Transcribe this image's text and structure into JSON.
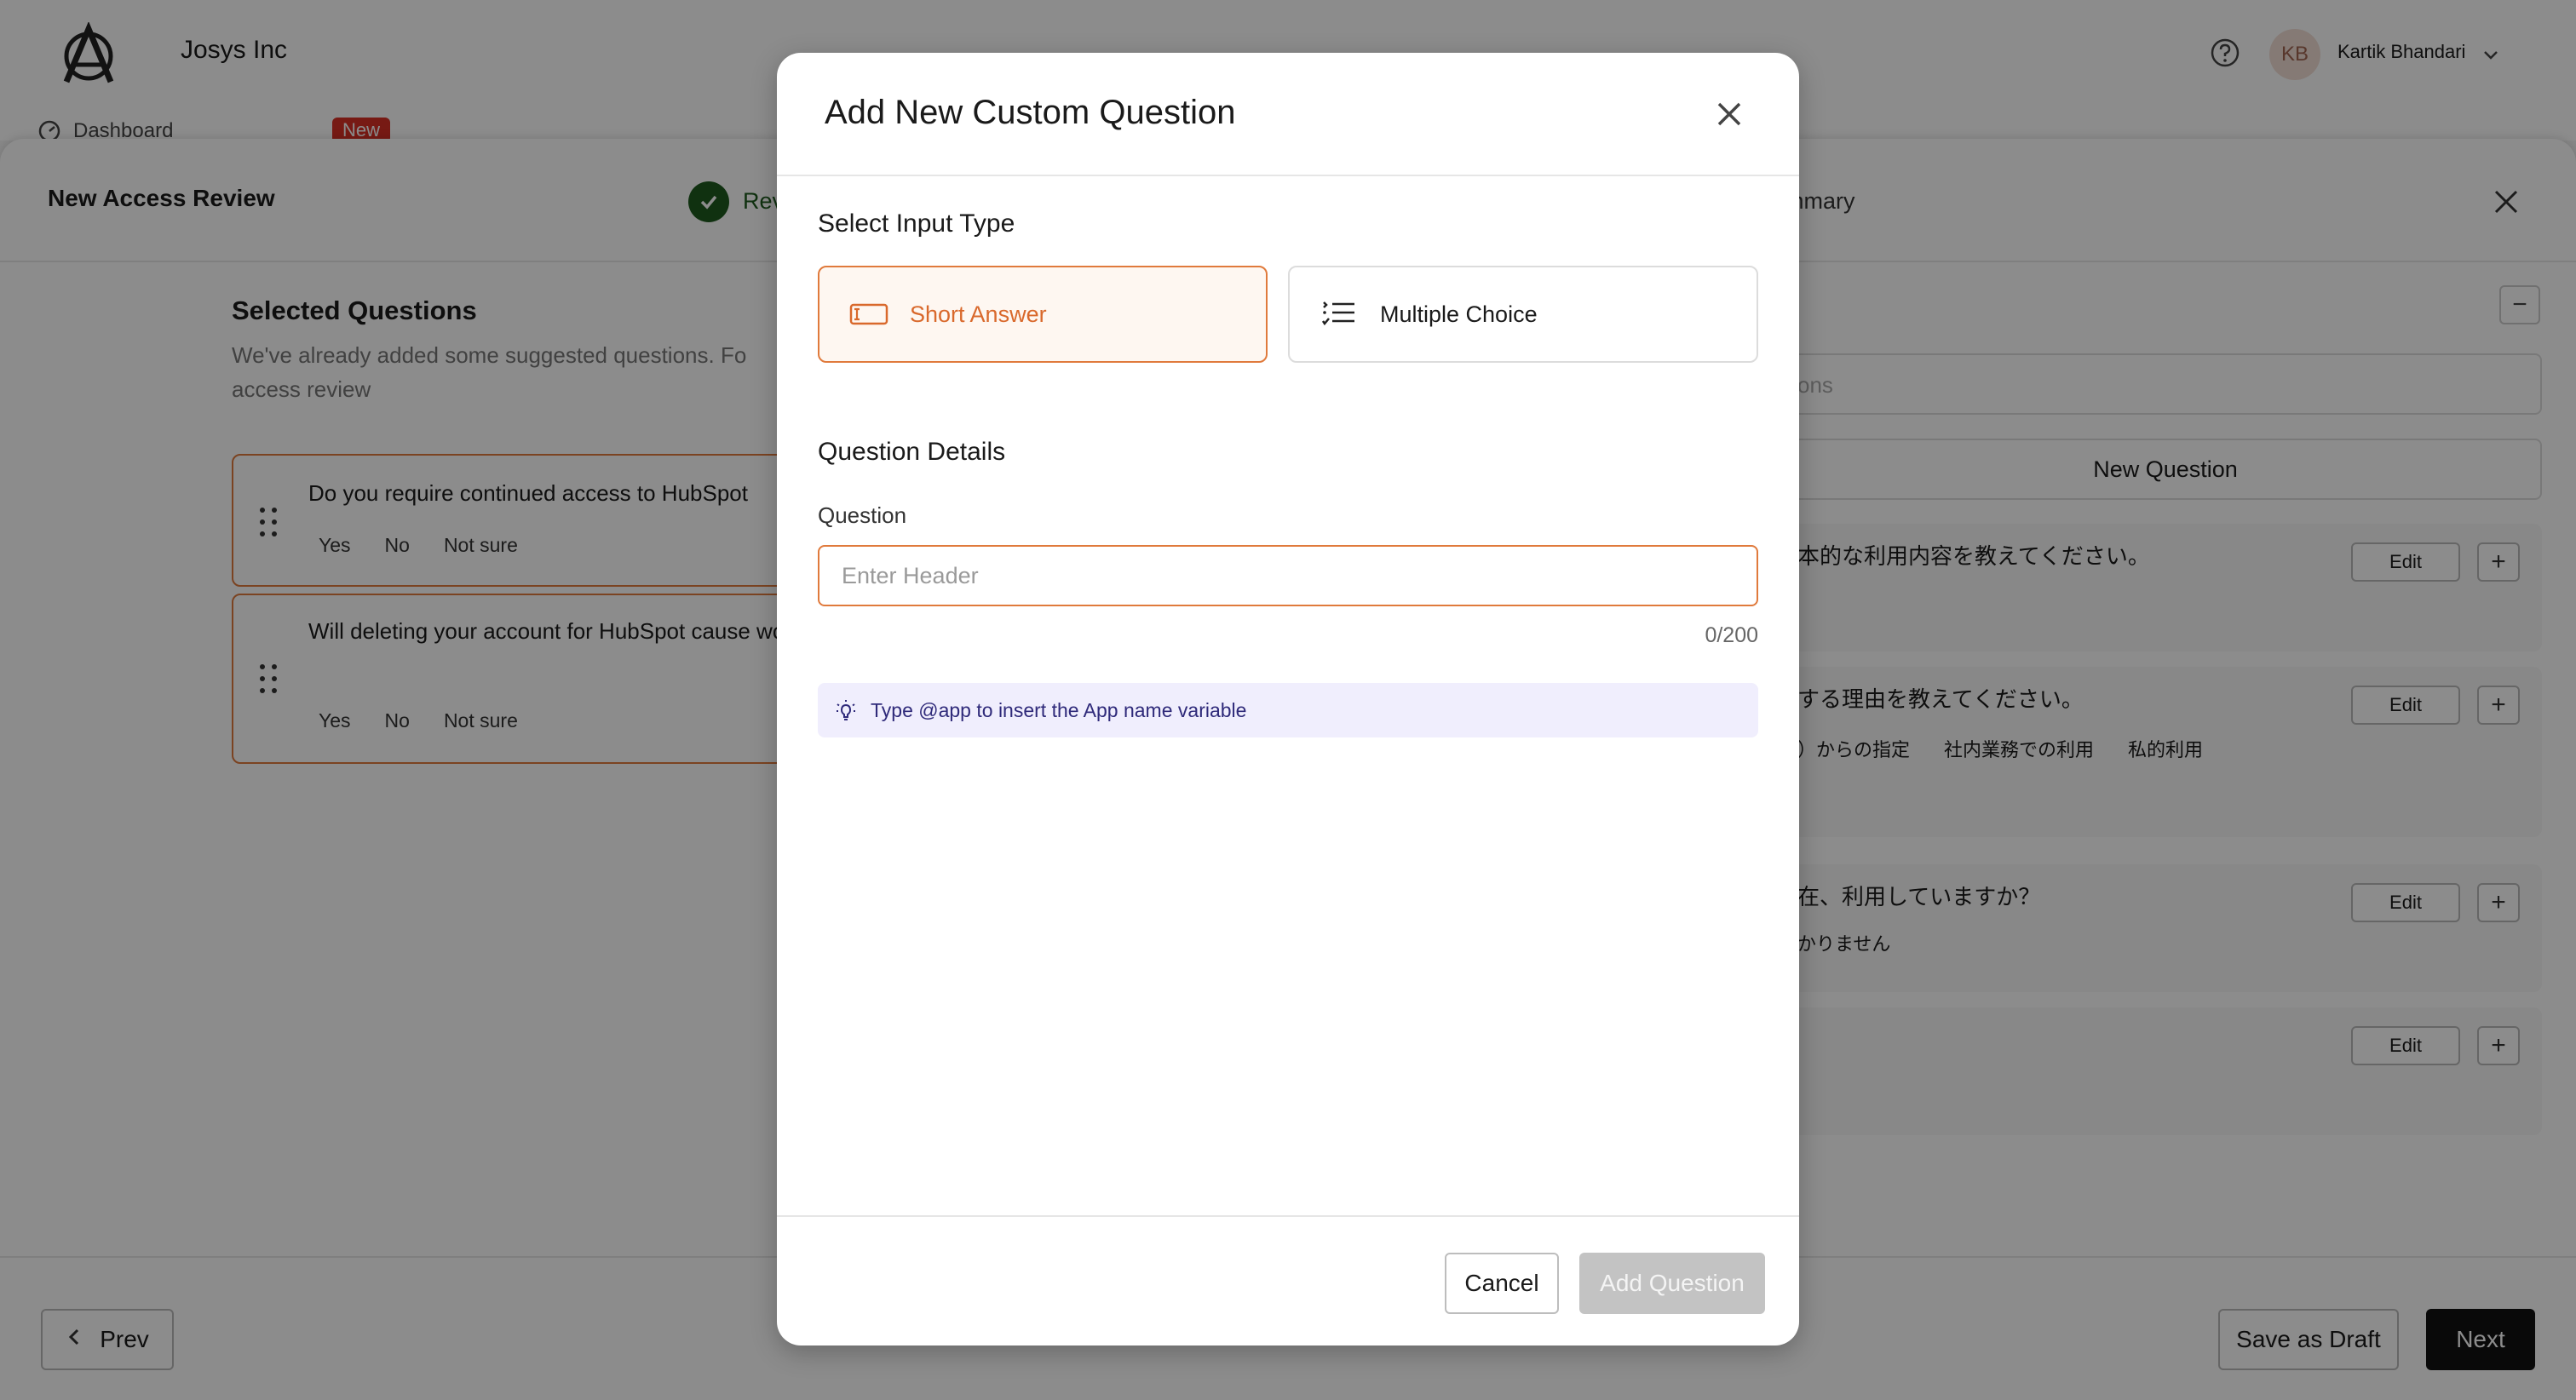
{
  "app": {
    "org_name": "Josys Inc",
    "nav_dashboard": "Dashboard",
    "nav_badge": "New"
  },
  "user": {
    "initials": "KB",
    "name": "Kartik Bhandari"
  },
  "wizard": {
    "title": "New Access Review",
    "step_review_label": "Rev",
    "step_summary_label": "ummary",
    "selected_title": "Selected Questions",
    "selected_desc": "We've already added some suggested questions. Fo access review",
    "questions": [
      {
        "text": "Do you require continued access to HubSpot",
        "options": [
          "Yes",
          "No",
          "Not sure"
        ]
      },
      {
        "text": "Will deleting your account for HubSpot cause work?",
        "options": [
          "Yes",
          "No",
          "Not sure"
        ]
      }
    ],
    "right_search_placeholder": "ons",
    "right_new_question": "New Question",
    "right_questions": [
      {
        "text": "本的な利用内容を教えてください。",
        "options": []
      },
      {
        "text": "する理由を教えてください。",
        "options": [
          "）からの指定",
          "社内業務での利用",
          "私的利用"
        ]
      },
      {
        "text": "在、利用していますか？",
        "options": [
          "かりません"
        ]
      },
      {
        "text": "",
        "options": []
      }
    ],
    "edit_label": "Edit",
    "prev_label": "Prev",
    "save_draft_label": "Save as Draft",
    "next_label": "Next"
  },
  "modal": {
    "title": "Add New Custom Question",
    "select_type_title": "Select Input Type",
    "types": [
      {
        "label": "Short Answer",
        "selected": true,
        "icon": "text-field-icon"
      },
      {
        "label": "Multiple Choice",
        "selected": false,
        "icon": "list-icon"
      }
    ],
    "details_title": "Question Details",
    "question_label": "Question",
    "question_value": "",
    "question_placeholder": "Enter Header",
    "counter": "0/200",
    "hint": "Type @app to insert the App name variable",
    "cancel_label": "Cancel",
    "add_label": "Add Question"
  },
  "colors": {
    "accent": "#e07a3c",
    "primary_dark": "#111111",
    "success": "#1e5a1e",
    "hint_bg": "#f0eefd",
    "disabled": "#c3c3c3"
  }
}
